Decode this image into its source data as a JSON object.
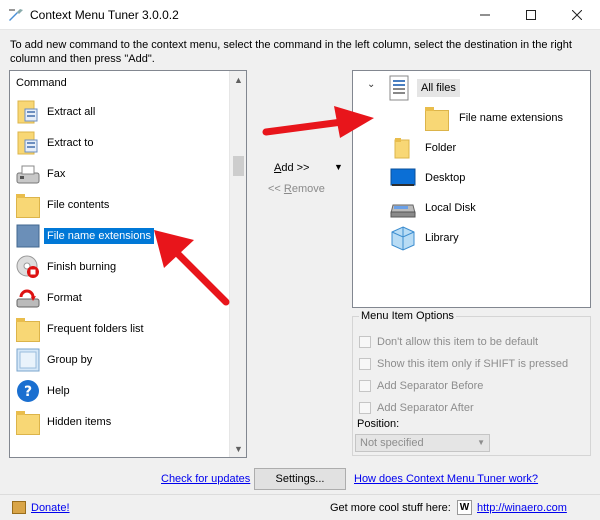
{
  "window": {
    "title": "Context Menu Tuner 3.0.0.2",
    "minimize_icon": "minimize-icon",
    "maximize_icon": "maximize-icon",
    "close_icon": "close-icon"
  },
  "instructions": "To add new command to the context menu, select the command in the left column, select the destination in the right column and then press \"Add\".",
  "command_list": {
    "header": "Command",
    "items": [
      {
        "label": "Extract all",
        "icon": "zip-folder-icon",
        "selected": false
      },
      {
        "label": "Extract to",
        "icon": "zip-folder-icon",
        "selected": false
      },
      {
        "label": "Fax",
        "icon": "fax-icon",
        "selected": false
      },
      {
        "label": "File contents",
        "icon": "folder-icon",
        "selected": false
      },
      {
        "label": "File name extensions",
        "icon": "folder-icon",
        "selected": true
      },
      {
        "label": "Finish burning",
        "icon": "burn-disc-icon",
        "selected": false
      },
      {
        "label": "Format",
        "icon": "format-icon",
        "selected": false
      },
      {
        "label": "Frequent folders list",
        "icon": "folder-icon",
        "selected": false
      },
      {
        "label": "Group by",
        "icon": "group-by-icon",
        "selected": false
      },
      {
        "label": "Help",
        "icon": "help-icon",
        "selected": false
      },
      {
        "label": "Hidden items",
        "icon": "folder-icon",
        "selected": false
      }
    ]
  },
  "actions": {
    "add_prefix": "A",
    "add_rest": "dd >>",
    "remove_prefix": "<< ",
    "remove_u": "R",
    "remove_rest": "emove",
    "dropdown_icon": "dropdown-arrow-icon"
  },
  "destination_tree": {
    "items": [
      {
        "label": "All files",
        "icon": "all-files-icon",
        "selected": true
      },
      {
        "label": "File name extensions",
        "icon": "folder-icon",
        "selected": false
      },
      {
        "label": "Folder",
        "icon": "folder-icon",
        "selected": false
      },
      {
        "label": "Desktop",
        "icon": "desktop-icon",
        "selected": false
      },
      {
        "label": "Local Disk",
        "icon": "drive-icon",
        "selected": false
      },
      {
        "label": "Library",
        "icon": "library-icon",
        "selected": false
      }
    ]
  },
  "menu_item_options": {
    "title": "Menu Item Options",
    "checkboxes": [
      {
        "label": "Don't allow this item to be default",
        "checked": false
      },
      {
        "label": "Show this item only if SHIFT is pressed",
        "checked": false
      },
      {
        "label": "Add Separator Before",
        "checked": false
      },
      {
        "label": "Add Separator After",
        "checked": false
      }
    ],
    "position_label": "Position:",
    "position_value": "Not specified"
  },
  "links": {
    "check_updates": "Check for updates",
    "settings": "Settings...",
    "how_works": "How does Context Menu Tuner work?",
    "donate": "Donate!",
    "footer_text": "Get more cool stuff here:",
    "winaero_url": "http://winaero.com"
  },
  "colors": {
    "selection": "#0078d7",
    "arrow": "#e8151b",
    "folder": "#f8d775"
  }
}
